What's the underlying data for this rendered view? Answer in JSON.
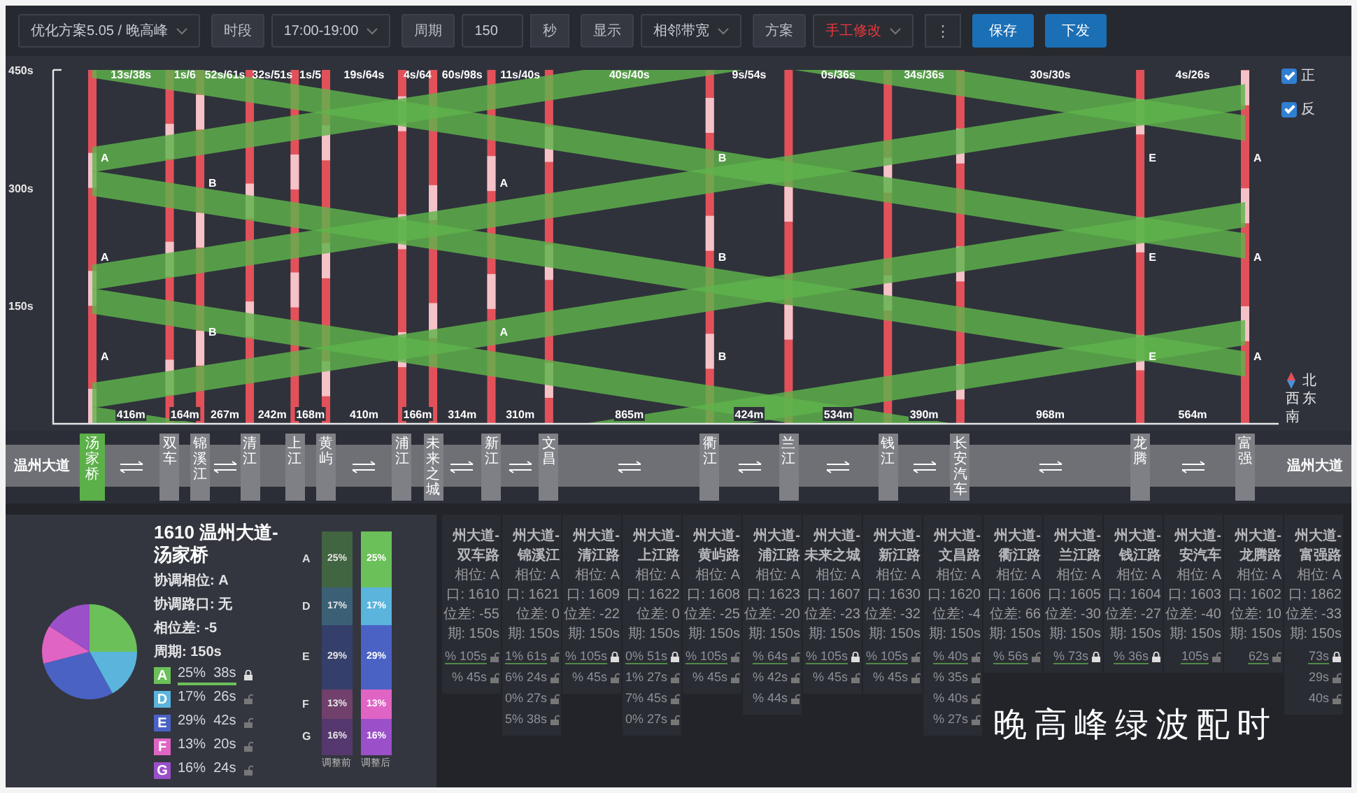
{
  "toolbar": {
    "plan_select": "优化方案5.05 / 晚高峰",
    "fields": [
      {
        "kind": "select",
        "label": "时段",
        "value": "17:00-19:00",
        "modified": false
      },
      {
        "kind": "number",
        "label": "周期",
        "value": "150",
        "unit": "秒"
      },
      {
        "kind": "select",
        "label": "显示",
        "value": "相邻带宽",
        "modified": false
      },
      {
        "kind": "select",
        "label": "方案",
        "value": "手工修改",
        "modified": true
      }
    ],
    "more_button": "⋮",
    "buttons": [
      "保存",
      "下发"
    ]
  },
  "diagram": {
    "y_axis_labels": [
      "450s",
      "300s",
      "150s"
    ],
    "direction_toggles": [
      {
        "label": "正",
        "checked": true
      },
      {
        "label": "反",
        "checked": true
      }
    ],
    "compass": {
      "north": "北",
      "west": "西",
      "east": "东",
      "south": "南"
    },
    "band_labels": [
      "13s/38s",
      "1s/6",
      "52s/61s",
      "32s/51s",
      "1s/5",
      "19s/64s",
      "4s/64",
      "60s/98s",
      "11s/40s",
      "40s/40s",
      "9s/54s",
      "0s/36s",
      "34s/36s",
      "30s/30s",
      "4s/26s"
    ],
    "distances": [
      "416m",
      "164m",
      "267m",
      "242m",
      "168m",
      "410m",
      "166m",
      "314m",
      "310m",
      "865m",
      "424m",
      "534m",
      "390m",
      "968m",
      "564m"
    ],
    "intersections": [
      {
        "name": "汤家桥",
        "selected": true,
        "phase_marks": [
          "A",
          "A",
          "A"
        ]
      },
      {
        "name": "双车",
        "selected": false
      },
      {
        "name": "锦溪江",
        "selected": false,
        "phase_marks": [
          "B",
          "B"
        ]
      },
      {
        "name": "清江",
        "selected": false
      },
      {
        "name": "上江",
        "selected": false
      },
      {
        "name": "黄屿",
        "selected": false
      },
      {
        "name": "浦江",
        "selected": false
      },
      {
        "name": "未来之城",
        "selected": false
      },
      {
        "name": "新江",
        "selected": false,
        "phase_marks": [
          "A",
          "A"
        ]
      },
      {
        "name": "文昌",
        "selected": false
      },
      {
        "name": "衢江",
        "selected": false,
        "phase_marks": [
          "B",
          "B",
          "B"
        ]
      },
      {
        "name": "兰江",
        "selected": false
      },
      {
        "name": "钱江",
        "selected": false
      },
      {
        "name": "长安汽车",
        "selected": false
      },
      {
        "name": "龙腾",
        "selected": false,
        "phase_marks": [
          "E",
          "E",
          "E"
        ]
      },
      {
        "name": "富强",
        "selected": false,
        "phase_marks": [
          "A",
          "A",
          "A"
        ]
      }
    ],
    "road_ends": [
      "温州大道",
      "温州大道"
    ]
  },
  "detail": {
    "title": "1610 温州大道-汤家桥",
    "info": [
      "协调相位: A",
      "协调路口: 无",
      "相位差: -5",
      "周期: 150s"
    ],
    "chart_data": {
      "type": "pie",
      "categories": [
        "A",
        "D",
        "E",
        "F",
        "G"
      ],
      "values": [
        25,
        17,
        29,
        13,
        16
      ]
    },
    "phases": [
      {
        "color": "#6cc05a",
        "ratio": "25%",
        "duration": "38s",
        "locked": true,
        "coordinated": true
      },
      {
        "color": "#5ab4dc",
        "ratio": "17%",
        "duration": "26s",
        "locked": false,
        "coordinated": false
      },
      {
        "color": "#4a62c4",
        "ratio": "29%",
        "duration": "42s",
        "locked": false,
        "coordinated": false
      },
      {
        "color": "#e064c4",
        "ratio": "13%",
        "duration": "20s",
        "locked": false,
        "coordinated": false
      },
      {
        "color": "#9b4fc9",
        "ratio": "16%",
        "duration": "24s",
        "locked": false,
        "coordinated": false
      }
    ],
    "split_bars": {
      "row_labels": [
        "A",
        "D",
        "E",
        "F",
        "G"
      ],
      "columns": [
        {
          "label": "调整前",
          "dimmed": true,
          "values": [
            "25%",
            "17%",
            "29%",
            "13%",
            "16%"
          ]
        },
        {
          "label": "调整后",
          "dimmed": false,
          "values": [
            "25%",
            "17%",
            "29%",
            "13%",
            "16%"
          ]
        }
      ]
    }
  },
  "cards": [
    {
      "title": [
        "州大道-",
        "双车路"
      ],
      "lines": [
        "相位: A",
        "口: 1610",
        "位差: -55",
        "期: 150s"
      ],
      "phases": [
        {
          "text": "% 105s",
          "locked": false,
          "coordinated": true
        },
        {
          "text": "% 45s",
          "locked": false,
          "coordinated": false
        }
      ]
    },
    {
      "title": [
        "州大道-",
        "锦溪江"
      ],
      "lines": [
        "相位: A",
        "口: 1621",
        "位差: 0",
        "期: 150s"
      ],
      "phases": [
        {
          "text": "1% 61s",
          "locked": false,
          "coordinated": true
        },
        {
          "text": "6% 24s",
          "locked": false,
          "coordinated": false
        },
        {
          "text": "0% 27s",
          "locked": false,
          "coordinated": false
        },
        {
          "text": "5% 38s",
          "locked": false,
          "coordinated": false
        }
      ]
    },
    {
      "title": [
        "州大道-",
        "清江路"
      ],
      "lines": [
        "相位: A",
        "口: 1609",
        "位差: -22",
        "期: 150s"
      ],
      "phases": [
        {
          "text": "% 105s",
          "locked": true,
          "coordinated": true
        },
        {
          "text": "% 45s",
          "locked": false,
          "coordinated": false
        }
      ]
    },
    {
      "title": [
        "州大道-",
        "上江路"
      ],
      "lines": [
        "相位: A",
        "口: 1622",
        "位差: 0",
        "期: 150s"
      ],
      "phases": [
        {
          "text": "0% 51s",
          "locked": true,
          "coordinated": true
        },
        {
          "text": "1% 27s",
          "locked": false,
          "coordinated": false
        },
        {
          "text": "7% 45s",
          "locked": false,
          "coordinated": false
        },
        {
          "text": "0% 27s",
          "locked": false,
          "coordinated": false
        }
      ]
    },
    {
      "title": [
        "州大道-",
        "黄屿路"
      ],
      "lines": [
        "相位: A",
        "口: 1608",
        "位差: -25",
        "期: 150s"
      ],
      "phases": [
        {
          "text": "% 105s",
          "locked": false,
          "coordinated": true
        },
        {
          "text": "% 45s",
          "locked": false,
          "coordinated": false
        }
      ]
    },
    {
      "title": [
        "州大道-",
        "浦江路"
      ],
      "lines": [
        "相位: A",
        "口: 1623",
        "位差: -20",
        "期: 150s"
      ],
      "phases": [
        {
          "text": "% 64s",
          "locked": false,
          "coordinated": true
        },
        {
          "text": "% 42s",
          "locked": false,
          "coordinated": false
        },
        {
          "text": "% 44s",
          "locked": false,
          "coordinated": false
        }
      ]
    },
    {
      "title": [
        "州大道-",
        "未来之城"
      ],
      "lines": [
        "相位: A",
        "口: 1607",
        "位差: -23",
        "期: 150s"
      ],
      "phases": [
        {
          "text": "% 105s",
          "locked": true,
          "coordinated": true
        },
        {
          "text": "% 45s",
          "locked": false,
          "coordinated": false
        }
      ]
    },
    {
      "title": [
        "州大道-",
        "新江路"
      ],
      "lines": [
        "相位: A",
        "口: 1630",
        "位差: -32",
        "期: 150s"
      ],
      "phases": [
        {
          "text": "% 105s",
          "locked": false,
          "coordinated": true
        },
        {
          "text": "% 45s",
          "locked": false,
          "coordinated": false
        }
      ]
    },
    {
      "title": [
        "州大道-",
        "文昌路"
      ],
      "lines": [
        "相位: A",
        "口: 1620",
        "位差: -4",
        "期: 150s"
      ],
      "phases": [
        {
          "text": "% 40s",
          "locked": false,
          "coordinated": true
        },
        {
          "text": "% 35s",
          "locked": false,
          "coordinated": false
        },
        {
          "text": "% 40s",
          "locked": false,
          "coordinated": false
        },
        {
          "text": "% 27s",
          "locked": false,
          "coordinated": false
        }
      ]
    },
    {
      "title": [
        "州大道-",
        "衢江路"
      ],
      "lines": [
        "相位: A",
        "口: 1606",
        "位差: 66",
        "期: 150s"
      ],
      "phases": [
        {
          "text": "% 56s",
          "locked": false,
          "coordinated": true
        }
      ]
    },
    {
      "title": [
        "州大道-",
        "兰江路"
      ],
      "lines": [
        "相位: A",
        "口: 1605",
        "位差: -30",
        "期: 150s"
      ],
      "phases": [
        {
          "text": "% 73s",
          "locked": true,
          "coordinated": true
        }
      ]
    },
    {
      "title": [
        "州大道-",
        "钱江路"
      ],
      "lines": [
        "相位: A",
        "口: 1604",
        "位差: -27",
        "期: 150s"
      ],
      "phases": [
        {
          "text": "% 36s",
          "locked": true,
          "coordinated": true
        }
      ]
    },
    {
      "title": [
        "州大道-",
        "安汽车"
      ],
      "lines": [
        "相位: A",
        "口: 1603",
        "位差: -40",
        "期: 150s"
      ],
      "phases": [
        {
          "text": "105s",
          "locked": false,
          "coordinated": true
        }
      ]
    },
    {
      "title": [
        "州大道-",
        "龙腾路"
      ],
      "lines": [
        "相位: A",
        "口: 1602",
        "位差: 10",
        "期: 150s"
      ],
      "phases": [
        {
          "text": "62s",
          "locked": false,
          "coordinated": true
        }
      ]
    },
    {
      "title": [
        "州大道-",
        "富强路"
      ],
      "lines": [
        "相位: A",
        "口: 1862",
        "位差: -33",
        "期: 150s"
      ],
      "phases": [
        {
          "text": "73s",
          "locked": true,
          "coordinated": true
        },
        {
          "text": "29s",
          "locked": false,
          "coordinated": false
        },
        {
          "text": "40s",
          "locked": false,
          "coordinated": false
        }
      ]
    }
  ],
  "caption": "晚高峰绿波配时"
}
